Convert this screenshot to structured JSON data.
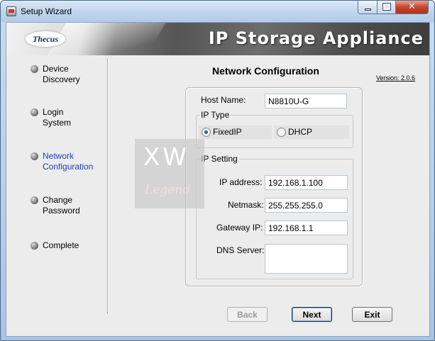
{
  "window": {
    "title": "Setup Wizard"
  },
  "banner": {
    "logo_text": "Thecus",
    "title": "IP Storage Appliance"
  },
  "sidebar": {
    "steps": [
      {
        "label": "Device\nDiscovery",
        "active": false
      },
      {
        "label": "Login\nSystem",
        "active": false
      },
      {
        "label": "Network\nConfiguration",
        "active": true
      },
      {
        "label": "Change\nPassword",
        "active": false
      },
      {
        "label": "Complete",
        "active": false
      }
    ]
  },
  "watermark": {
    "top": "XW",
    "bottom": "Legend"
  },
  "main": {
    "title": "Network Configuration",
    "version": "Version: 2.0.6",
    "host_name": {
      "label": "Host Name:",
      "value": "N8810U-G"
    },
    "ip_type": {
      "title": "IP Type",
      "options": [
        {
          "label": "FixedIP",
          "checked": true
        },
        {
          "label": "DHCP",
          "checked": false
        }
      ]
    },
    "ip_setting": {
      "title": "IP Setting",
      "ip_address": {
        "label": "IP address:",
        "value": "192.168.1.100"
      },
      "netmask": {
        "label": "Netmask:",
        "value": "255.255.255.0"
      },
      "gateway": {
        "label": "Gateway IP:",
        "value": "192.168.1.1"
      },
      "dns": {
        "label": "DNS Server:",
        "value": ""
      }
    }
  },
  "buttons": {
    "back": "Back",
    "next": "Next",
    "exit": "Exit"
  },
  "colors": {
    "active_step": "#1a3fc0",
    "radio_checked": "#2c5fae"
  }
}
